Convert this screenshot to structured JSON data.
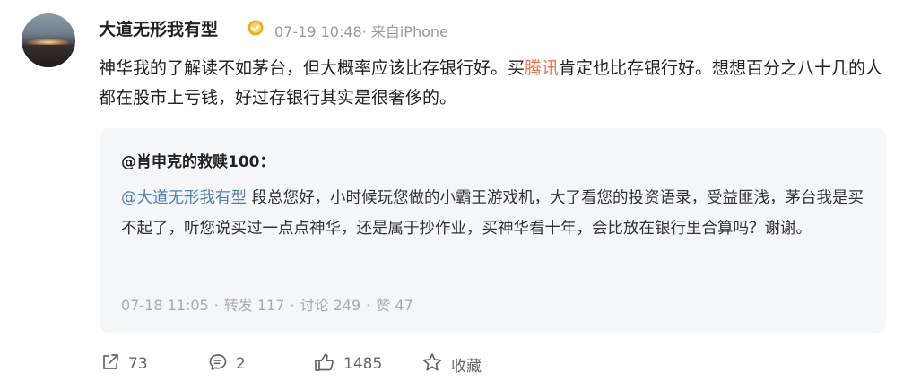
{
  "post": {
    "username": "大道无形我有型",
    "meta": "07-19 10:48· 来自iPhone",
    "text_part1": "神华我的了解读不如茅台，但大概率应该比存银行好。买",
    "text_link": "腾讯",
    "text_part2": "肯定也比存银行好。想想百分之八十几的人都在股市上亏钱，好过存银行其实是很奢侈的。"
  },
  "quote": {
    "author": "@肖申克的救赎100：",
    "mention": "@大道无形我有型",
    "text": " 段总您好，小时候玩您做的小霸王游戏机，大了看您的投资语录，受益匪浅，茅台我是买不起了，听您说买过一点点神华，还是属于抄作业，买神华看十年，会比放在银行里合算吗？谢谢。",
    "time": "07-18 11:05",
    "sep": "·",
    "reposts": "转发 117",
    "comments": "讨论 249",
    "likes": "赞 47"
  },
  "actions": {
    "share_count": "73",
    "comment_count": "2",
    "like_count": "1485",
    "favorite_label": "收藏"
  },
  "icons": {
    "badge": "gold-verified-badge-icon",
    "share": "share-icon",
    "comment": "comment-icon",
    "like": "thumbs-up-icon",
    "favorite": "star-icon"
  },
  "colors": {
    "link_orange": "#eb7350",
    "mention_blue": "#507daf",
    "meta_gray": "#999999",
    "quote_bg": "#f5f6f8",
    "badge_gold": "#f5a623"
  }
}
